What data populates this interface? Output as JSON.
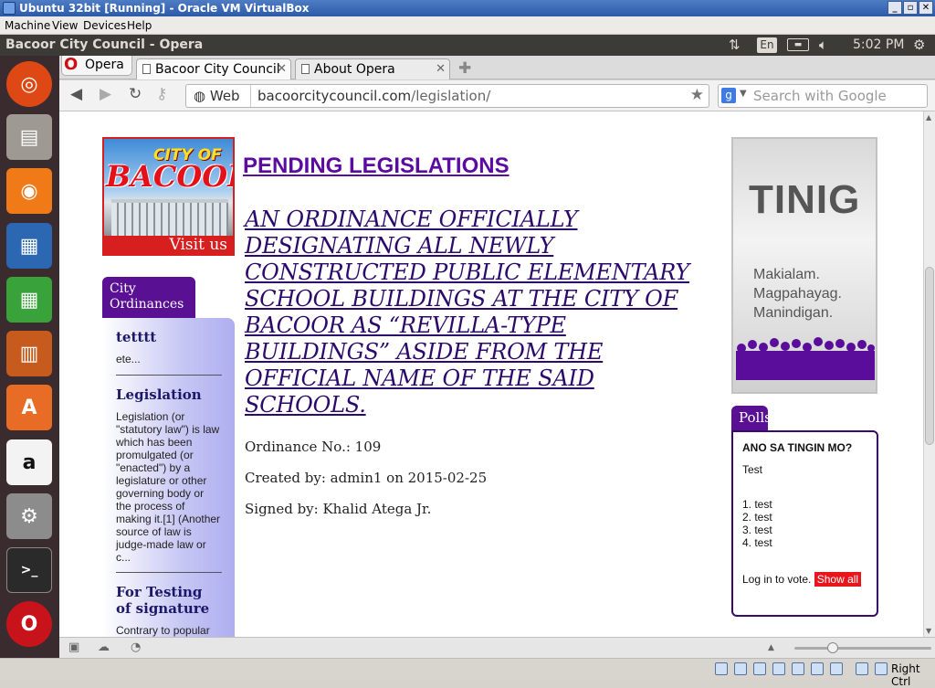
{
  "vbox": {
    "title": "Ubuntu 32bit [Running] - Oracle VM VirtualBox",
    "menu": [
      "Machine",
      "View",
      "Devices",
      "Help"
    ],
    "host_key": "Right Ctrl"
  },
  "panel": {
    "window_title": "Bacoor City Council - Opera",
    "keyboard_layout": "En",
    "clock": "5:02 PM"
  },
  "launcher": {
    "apps": [
      "Ubuntu Dash",
      "Files",
      "Firefox",
      "LibreOffice Writer",
      "LibreOffice Calc",
      "LibreOffice Impress",
      "Ubuntu Software Center",
      "Amazon",
      "System Settings",
      "Terminal",
      "Opera"
    ]
  },
  "browser": {
    "menu_label": "Opera",
    "tabs": [
      {
        "label": "Bacoor City Council",
        "active": true
      },
      {
        "label": "About Opera",
        "active": false
      }
    ],
    "web_label": "Web",
    "url_host": "bacoorcitycouncil.com",
    "url_path": "/legislation/",
    "search_placeholder": "Search with Google"
  },
  "page": {
    "logo": {
      "line1": "CITY OF",
      "line2": "BACOOR",
      "cta": "Visit us"
    },
    "sidebar": {
      "tab_label": "City Ordinances",
      "items": [
        {
          "title": "tetttt",
          "excerpt": "ete..."
        },
        {
          "title": "Legislation",
          "excerpt": "Legislation (or \"statutory law\") is law which has been promulgated (or \"enacted\") by a legislature or other governing body or the process of making it.[1] (Another source of law is judge-made law or c..."
        },
        {
          "title": "For Testing of signature",
          "excerpt": "Contrary to popular"
        }
      ]
    },
    "heading": "PENDING LEGISLATIONS",
    "ordinance": {
      "title": "AN ORDINANCE OFFICIALLY DESIGNATING ALL NEWLY CONSTRUCTED PUBLIC ELEMENTARY SCHOOL BUILDINGS AT THE CITY OF BACOOR AS “REVILLA-TYPE BUILDINGS” ASIDE FROM THE OFFICIAL NAME OF THE SAID SCHOOLS.",
      "number_line": "Ordinance No.: 109",
      "created_line": "Created by: admin1 on 2015-02-25",
      "signed_line": "Signed by: Khalid Atega Jr."
    },
    "tinig": {
      "title": "TINIG",
      "lines": [
        "Makialam.",
        "Magpahayag.",
        "Manindigan."
      ]
    },
    "polls": {
      "tab_label": "Polls",
      "question": "ANO SA TINGIN MO?",
      "description": "Test",
      "options": [
        "1. test",
        "2. test",
        "3. test",
        "4. test"
      ],
      "login_text": "Log in to vote.",
      "show_all": "Show all"
    }
  }
}
